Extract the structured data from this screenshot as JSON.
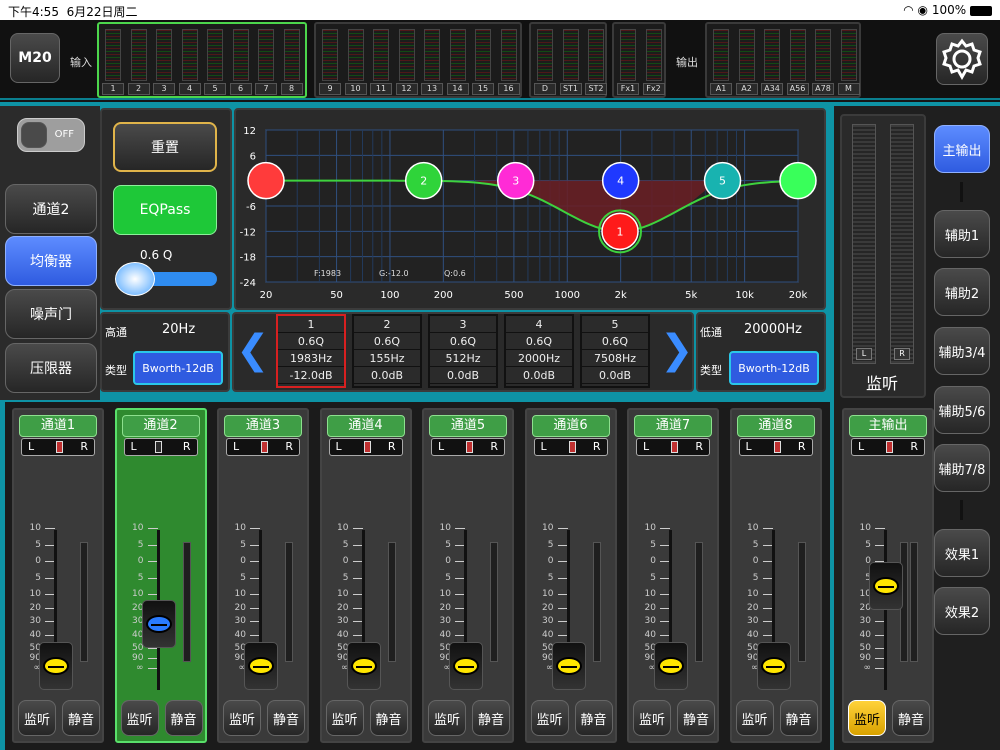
{
  "status_bar": {
    "time": "下午4:55",
    "date": "6月22日周二",
    "battery": "100%"
  },
  "top_bar": {
    "device": "M20",
    "input_label": "输入",
    "output_label": "输出",
    "inputs_1": [
      "1",
      "2",
      "3",
      "4",
      "5",
      "6",
      "7",
      "8"
    ],
    "inputs_2": [
      "9",
      "10",
      "11",
      "12",
      "13",
      "14",
      "15",
      "16"
    ],
    "inputs_3": [
      "D",
      "ST1",
      "ST2"
    ],
    "inputs_4": [
      "Fx1",
      "Fx2"
    ],
    "outputs": [
      "A1",
      "A2",
      "A34",
      "A56",
      "A78",
      "M"
    ]
  },
  "left_panel": {
    "toggle": "OFF",
    "tabs": [
      "通道2",
      "均衡器",
      "噪声门",
      "压限器"
    ],
    "active_tab": "均衡器"
  },
  "eq": {
    "reset_label": "重置",
    "eqpass_label": "EQPass",
    "q_label": "0.6 Q",
    "q_value": 0.2,
    "graph": {
      "y_ticks": [
        "12",
        "6",
        "0",
        "-6",
        "-12",
        "-18",
        "-24"
      ],
      "x_ticks": [
        "20",
        "50",
        "100",
        "200",
        "500",
        "1000",
        "2k",
        "5k",
        "10k",
        "20k"
      ],
      "readout_f": "F:1983",
      "readout_g": "G:-12.0",
      "readout_q": "Q:0.6"
    },
    "highpass": {
      "label": "高通",
      "freq": "20Hz",
      "type_label": "类型",
      "type": "Bworth-12dB"
    },
    "lowpass": {
      "label": "低通",
      "freq": "20000Hz",
      "type_label": "类型",
      "type": "Bworth-12dB"
    },
    "bands": [
      {
        "n": "1",
        "q": "0.6Q",
        "f": "1983Hz",
        "g": "-12.0dB"
      },
      {
        "n": "2",
        "q": "0.6Q",
        "f": "155Hz",
        "g": "0.0dB"
      },
      {
        "n": "3",
        "q": "0.6Q",
        "f": "512Hz",
        "g": "0.0dB"
      },
      {
        "n": "4",
        "q": "0.6Q",
        "f": "2000Hz",
        "g": "0.0dB"
      },
      {
        "n": "5",
        "q": "0.6Q",
        "f": "7508Hz",
        "g": "0.0dB"
      }
    ],
    "node_labels": [
      "1",
      "2",
      "3",
      "4",
      "5"
    ]
  },
  "meter_panel": {
    "label": "监听",
    "l": "L",
    "r": "R"
  },
  "right_buttons": [
    "主输出",
    "辅助1",
    "辅助2",
    "辅助3/4",
    "辅助5/6",
    "辅助7/8",
    "效果1",
    "效果2"
  ],
  "fader_scale": [
    "10",
    "5",
    "0",
    "5",
    "10",
    "20",
    "30",
    "40",
    "50",
    "90",
    "∞"
  ],
  "channels": [
    {
      "name": "通道1",
      "monitor": "监听",
      "mute": "静音",
      "L": "L",
      "R": "R"
    },
    {
      "name": "通道2",
      "monitor": "监听",
      "mute": "静音",
      "L": "L",
      "R": "R"
    },
    {
      "name": "通道3",
      "monitor": "监听",
      "mute": "静音",
      "L": "L",
      "R": "R"
    },
    {
      "name": "通道4",
      "monitor": "监听",
      "mute": "静音",
      "L": "L",
      "R": "R"
    },
    {
      "name": "通道5",
      "monitor": "监听",
      "mute": "静音",
      "L": "L",
      "R": "R"
    },
    {
      "name": "通道6",
      "monitor": "监听",
      "mute": "静音",
      "L": "L",
      "R": "R"
    },
    {
      "name": "通道7",
      "monitor": "监听",
      "mute": "静音",
      "L": "L",
      "R": "R"
    },
    {
      "name": "通道8",
      "monitor": "监听",
      "mute": "静音",
      "L": "L",
      "R": "R"
    }
  ],
  "master": {
    "name": "主输出",
    "monitor": "监听",
    "mute": "静音",
    "L": "L",
    "R": "R"
  }
}
